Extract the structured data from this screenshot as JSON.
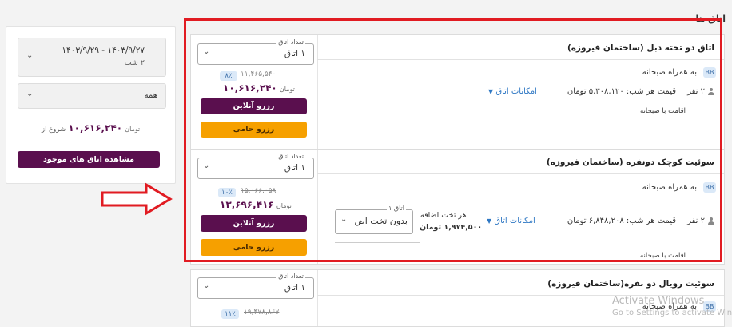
{
  "section_title": "اتاق ها",
  "sidebar": {
    "dates": "۱۴۰۳/۹/۲۷ - ۱۴۰۳/۹/۲۹",
    "nights": "۲ شب",
    "filter_value": "همه",
    "starting_from_label": "شروع از",
    "starting_price": "۱۰,۶۱۶,۲۴۰",
    "currency": "تومان",
    "view_rooms_label": "مشاهده اتاق های موجود"
  },
  "rooms": [
    {
      "title": "اتاق دو تخته دبل (ساختمان فیروزه)",
      "badge": "BB",
      "breakfast": "به همراه صبحانه",
      "persons": "۲ نفر",
      "nightly_price": "قیمت هر شب: ۵,۳۰۸,۱۲۰ تومان",
      "facilities": "امکانات اتاق",
      "stay_note": "اقامت با صبحانه",
      "qty_label": "تعداد اتاق",
      "qty_value": "۱ اتاق",
      "discount": "۸٪",
      "old_price": "۱۱,۴۶۵,۵۴۰",
      "new_price": "۱۰,۶۱۶,۲۴۰",
      "currency": "تومان",
      "online_label": "رزرو آنلاین",
      "sponsor_label": "رزرو حامی"
    },
    {
      "title": "سوئیت کوچک دونفره (ساختمان فیروزه)",
      "badge": "BB",
      "breakfast": "به همراه صبحانه",
      "persons": "۲ نفر",
      "nightly_price": "قیمت هر شب: ۶,۸۴۸,۲۰۸ تومان",
      "facilities": "امکانات اتاق",
      "stay_note": "اقامت با صبحانه",
      "extra_bed_label": "هر تخت اضافه",
      "extra_bed_price": "۱,۹۷۴,۵۰۰ تومان",
      "extra_select_legend": "اتاق ۱",
      "extra_select_value": "بدون تخت اض",
      "qty_label": "تعداد اتاق",
      "qty_value": "۱ اتاق",
      "discount": "۱۰٪",
      "old_price": "۱۵,۰۶۶,۰۵۸",
      "new_price": "۱۳,۶۹۶,۴۱۶",
      "currency": "تومان",
      "online_label": "رزرو آنلاین",
      "sponsor_label": "رزرو حامی"
    },
    {
      "title": "سوئیت رویال دو نفره(ساختمان فیروزه)",
      "badge": "BB",
      "breakfast": "به همراه صبحانه",
      "qty_label": "تعداد اتاق",
      "qty_value": "۱ اتاق",
      "discount": "۱۱٪",
      "old_price": "۱۹,۴۷۸,۸۶۷"
    }
  ],
  "watermark": {
    "line1": "Activate Windows",
    "line2": "Go to Settings to activate Windows."
  },
  "colors": {
    "brand_purple": "#5a0f4e",
    "sponsor_orange": "#f6a000",
    "highlight_red": "#e11b22",
    "badge_blue": "#dbe9f8"
  }
}
